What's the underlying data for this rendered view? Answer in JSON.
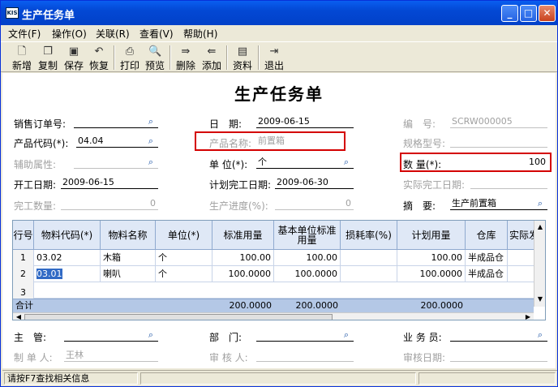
{
  "window": {
    "title": "生产任务单",
    "app_icon": "KIS",
    "min_icon": "minimize-icon",
    "max_icon": "maximize-icon",
    "close_icon": "close-icon"
  },
  "menu": [
    "文件(F)",
    "操作(O)",
    "关联(R)",
    "查看(V)",
    "帮助(H)"
  ],
  "toolbar": {
    "new": "新增",
    "copy": "复制",
    "save": "保存",
    "restore": "恢复",
    "print": "打印",
    "preview": "预览",
    "delete": "删除",
    "add": "添加",
    "data": "资料",
    "exit": "退出"
  },
  "doc_title": "生产任务单",
  "form": {
    "sales_order_label": "销售订单号:",
    "sales_order_value": "",
    "date_label": "日　期:",
    "date_value": "2009-06-15",
    "number_label": "编　号:",
    "number_value": "SCRW000005",
    "product_code_label": "产品代码(*):",
    "product_code_value": "04.04",
    "product_name_label": "产品名称:",
    "product_name_value": "前置箱",
    "spec_label": "规格型号:",
    "spec_value": "",
    "aux_label": "辅助属性:",
    "aux_value": "",
    "unit_label": "单 位(*):",
    "unit_value": "个",
    "qty_label": "数 量(*):",
    "qty_value": "100",
    "start_label": "开工日期:",
    "start_value": "2009-06-15",
    "plan_finish_label": "计划完工日期:",
    "plan_finish_value": "2009-06-30",
    "actual_finish_label": "实际完工日期:",
    "actual_finish_value": "",
    "completed_label": "完工数量:",
    "completed_value": "0",
    "progress_label": "生产进度(%):",
    "progress_value": "0",
    "summary_label": "摘　要:",
    "summary_value": "生产前置箱",
    "supervisor_label": "主　管:",
    "supervisor_value": "",
    "dept_label": "部　门:",
    "dept_value": "",
    "sales_label": "业 务 员:",
    "sales_value": "",
    "maker_label": "制 单 人:",
    "maker_value": "王林",
    "reviewer_label": "审 核 人:",
    "reviewer_value": "",
    "review_date_label": "审核日期:",
    "review_date_value": ""
  },
  "grid": {
    "headers": [
      "行号",
      "物料代码(*)",
      "物料名称",
      "单位(*)",
      "标准用量",
      "基本单位标准用量",
      "损耗率(%)",
      "计划用量",
      "仓库",
      "实际发"
    ],
    "rows": [
      {
        "no": "1",
        "code": "03.02",
        "name": "木箱",
        "unit": "个",
        "std": "100.00",
        "base_std": "100.00",
        "loss": "",
        "plan": "100.00",
        "wh": "半成品仓"
      },
      {
        "no": "2",
        "code": "03.01",
        "name": "喇叭",
        "unit": "个",
        "std": "100.0000",
        "base_std": "100.0000",
        "loss": "",
        "plan": "100.0000",
        "wh": "半成品仓"
      },
      {
        "no": "3",
        "code": "",
        "name": "",
        "unit": "",
        "std": "",
        "base_std": "",
        "loss": "",
        "plan": "",
        "wh": ""
      }
    ],
    "total_label": "合计",
    "total_std": "200.0000",
    "total_base_std": "200.0000",
    "total_plan": "200.0000"
  },
  "status": {
    "hint": "请按F7查找相关信息"
  },
  "colors": {
    "titlebar": "#0348d4",
    "highlight_box": "#d40000",
    "grid_header": "#dfe8f6",
    "sum_row": "#b4c8e6"
  }
}
